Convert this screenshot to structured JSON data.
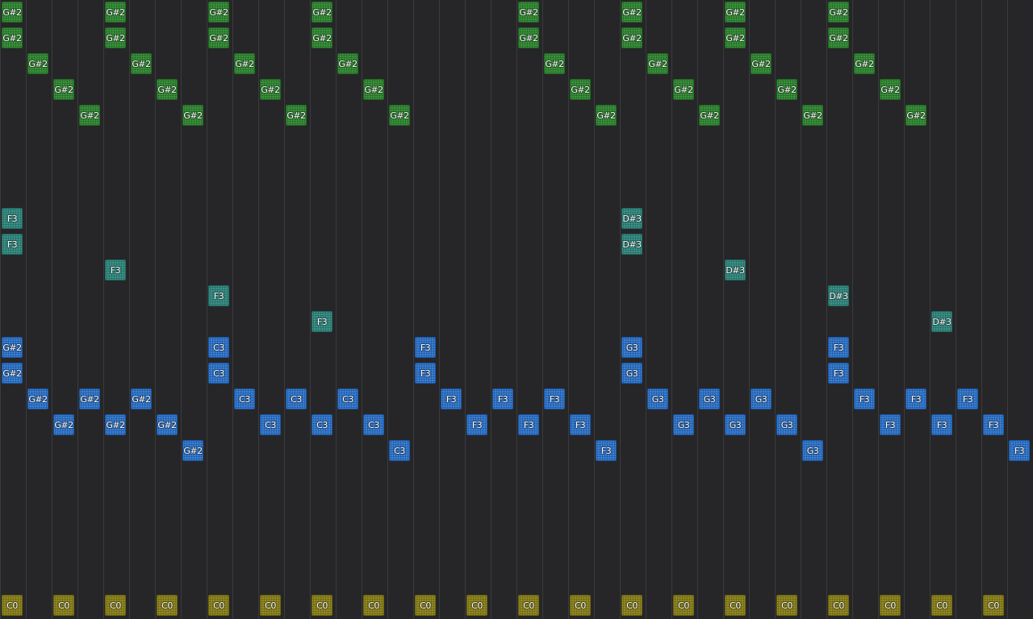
{
  "sequencer": {
    "columns": 40,
    "lanes": [
      {
        "id": "green",
        "color": "#2f8a31",
        "notes": [
          {
            "step": 0,
            "row": 0,
            "label": "G#2"
          },
          {
            "step": 0,
            "row": 1,
            "label": "G#2"
          },
          {
            "step": 1,
            "row": 2,
            "label": "G#2"
          },
          {
            "step": 2,
            "row": 3,
            "label": "G#2"
          },
          {
            "step": 3,
            "row": 4,
            "label": "G#2"
          },
          {
            "step": 4,
            "row": 0,
            "label": "G#2"
          },
          {
            "step": 4,
            "row": 1,
            "label": "G#2"
          },
          {
            "step": 5,
            "row": 2,
            "label": "G#2"
          },
          {
            "step": 6,
            "row": 3,
            "label": "G#2"
          },
          {
            "step": 7,
            "row": 4,
            "label": "G#2"
          },
          {
            "step": 8,
            "row": 0,
            "label": "G#2"
          },
          {
            "step": 8,
            "row": 1,
            "label": "G#2"
          },
          {
            "step": 9,
            "row": 2,
            "label": "G#2"
          },
          {
            "step": 10,
            "row": 3,
            "label": "G#2"
          },
          {
            "step": 11,
            "row": 4,
            "label": "G#2"
          },
          {
            "step": 12,
            "row": 0,
            "label": "G#2"
          },
          {
            "step": 12,
            "row": 1,
            "label": "G#2"
          },
          {
            "step": 13,
            "row": 2,
            "label": "G#2"
          },
          {
            "step": 14,
            "row": 3,
            "label": "G#2"
          },
          {
            "step": 15,
            "row": 4,
            "label": "G#2"
          },
          {
            "step": 20,
            "row": 0,
            "label": "G#2"
          },
          {
            "step": 20,
            "row": 1,
            "label": "G#2"
          },
          {
            "step": 21,
            "row": 2,
            "label": "G#2"
          },
          {
            "step": 22,
            "row": 3,
            "label": "G#2"
          },
          {
            "step": 23,
            "row": 4,
            "label": "G#2"
          },
          {
            "step": 24,
            "row": 0,
            "label": "G#2"
          },
          {
            "step": 24,
            "row": 1,
            "label": "G#2"
          },
          {
            "step": 25,
            "row": 2,
            "label": "G#2"
          },
          {
            "step": 26,
            "row": 3,
            "label": "G#2"
          },
          {
            "step": 27,
            "row": 4,
            "label": "G#2"
          },
          {
            "step": 28,
            "row": 0,
            "label": "G#2"
          },
          {
            "step": 28,
            "row": 1,
            "label": "G#2"
          },
          {
            "step": 29,
            "row": 2,
            "label": "G#2"
          },
          {
            "step": 30,
            "row": 3,
            "label": "G#2"
          },
          {
            "step": 31,
            "row": 4,
            "label": "G#2"
          },
          {
            "step": 32,
            "row": 0,
            "label": "G#2"
          },
          {
            "step": 32,
            "row": 1,
            "label": "G#2"
          },
          {
            "step": 33,
            "row": 2,
            "label": "G#2"
          },
          {
            "step": 34,
            "row": 3,
            "label": "G#2"
          },
          {
            "step": 35,
            "row": 4,
            "label": "G#2"
          }
        ]
      },
      {
        "id": "teal",
        "color": "#2f8a80",
        "notes": [
          {
            "step": 0,
            "row": 8,
            "label": "F3"
          },
          {
            "step": 0,
            "row": 9,
            "label": "F3"
          },
          {
            "step": 4,
            "row": 10,
            "label": "F3"
          },
          {
            "step": 8,
            "row": 11,
            "label": "F3"
          },
          {
            "step": 12,
            "row": 12,
            "label": "F3"
          },
          {
            "step": 24,
            "row": 8,
            "label": "D#3"
          },
          {
            "step": 24,
            "row": 9,
            "label": "D#3"
          },
          {
            "step": 28,
            "row": 10,
            "label": "D#3"
          },
          {
            "step": 32,
            "row": 11,
            "label": "D#3"
          },
          {
            "step": 36,
            "row": 12,
            "label": "D#3"
          }
        ]
      },
      {
        "id": "blue",
        "color": "#2a74d0",
        "notes": [
          {
            "step": 0,
            "row": 13,
            "label": "G#2"
          },
          {
            "step": 0,
            "row": 14,
            "label": "G#2"
          },
          {
            "step": 1,
            "row": 15,
            "label": "G#2"
          },
          {
            "step": 2,
            "row": 16,
            "label": "G#2"
          },
          {
            "step": 3,
            "row": 15,
            "label": "G#2"
          },
          {
            "step": 4,
            "row": 16,
            "label": "G#2"
          },
          {
            "step": 5,
            "row": 15,
            "label": "G#2"
          },
          {
            "step": 6,
            "row": 16,
            "label": "G#2"
          },
          {
            "step": 7,
            "row": 17,
            "label": "G#2"
          },
          {
            "step": 8,
            "row": 13,
            "label": "C3"
          },
          {
            "step": 8,
            "row": 14,
            "label": "C3"
          },
          {
            "step": 9,
            "row": 15,
            "label": "C3"
          },
          {
            "step": 10,
            "row": 16,
            "label": "C3"
          },
          {
            "step": 11,
            "row": 15,
            "label": "C3"
          },
          {
            "step": 12,
            "row": 16,
            "label": "C3"
          },
          {
            "step": 13,
            "row": 15,
            "label": "C3"
          },
          {
            "step": 14,
            "row": 16,
            "label": "C3"
          },
          {
            "step": 15,
            "row": 17,
            "label": "C3"
          },
          {
            "step": 16,
            "row": 13,
            "label": "F3"
          },
          {
            "step": 16,
            "row": 14,
            "label": "F3"
          },
          {
            "step": 17,
            "row": 15,
            "label": "F3"
          },
          {
            "step": 18,
            "row": 16,
            "label": "F3"
          },
          {
            "step": 19,
            "row": 15,
            "label": "F3"
          },
          {
            "step": 20,
            "row": 16,
            "label": "F3"
          },
          {
            "step": 21,
            "row": 15,
            "label": "F3"
          },
          {
            "step": 22,
            "row": 16,
            "label": "F3"
          },
          {
            "step": 23,
            "row": 17,
            "label": "F3"
          },
          {
            "step": 24,
            "row": 13,
            "label": "G3"
          },
          {
            "step": 24,
            "row": 14,
            "label": "G3"
          },
          {
            "step": 25,
            "row": 15,
            "label": "G3"
          },
          {
            "step": 26,
            "row": 16,
            "label": "G3"
          },
          {
            "step": 27,
            "row": 15,
            "label": "G3"
          },
          {
            "step": 28,
            "row": 16,
            "label": "G3"
          },
          {
            "step": 29,
            "row": 15,
            "label": "G3"
          },
          {
            "step": 30,
            "row": 16,
            "label": "G3"
          },
          {
            "step": 31,
            "row": 17,
            "label": "G3"
          },
          {
            "step": 32,
            "row": 13,
            "label": "F3"
          },
          {
            "step": 32,
            "row": 14,
            "label": "F3"
          },
          {
            "step": 33,
            "row": 15,
            "label": "F3"
          },
          {
            "step": 34,
            "row": 16,
            "label": "F3"
          },
          {
            "step": 35,
            "row": 15,
            "label": "F3"
          },
          {
            "step": 36,
            "row": 16,
            "label": "F3"
          },
          {
            "step": 37,
            "row": 15,
            "label": "F3"
          },
          {
            "step": 38,
            "row": 16,
            "label": "F3"
          },
          {
            "step": 39,
            "row": 17,
            "label": "F3"
          }
        ]
      },
      {
        "id": "olive",
        "color": "#8c8316",
        "notes": [
          {
            "step": 0,
            "row": 23,
            "label": "C0"
          },
          {
            "step": 2,
            "row": 23,
            "label": "C0"
          },
          {
            "step": 4,
            "row": 23,
            "label": "C0"
          },
          {
            "step": 6,
            "row": 23,
            "label": "C0"
          },
          {
            "step": 8,
            "row": 23,
            "label": "C0"
          },
          {
            "step": 10,
            "row": 23,
            "label": "C0"
          },
          {
            "step": 12,
            "row": 23,
            "label": "C0"
          },
          {
            "step": 14,
            "row": 23,
            "label": "C0"
          },
          {
            "step": 16,
            "row": 23,
            "label": "C0"
          },
          {
            "step": 18,
            "row": 23,
            "label": "C0"
          },
          {
            "step": 20,
            "row": 23,
            "label": "C0"
          },
          {
            "step": 22,
            "row": 23,
            "label": "C0"
          },
          {
            "step": 24,
            "row": 23,
            "label": "C0"
          },
          {
            "step": 26,
            "row": 23,
            "label": "C0"
          },
          {
            "step": 28,
            "row": 23,
            "label": "C0"
          },
          {
            "step": 30,
            "row": 23,
            "label": "C0"
          },
          {
            "step": 32,
            "row": 23,
            "label": "C0"
          },
          {
            "step": 34,
            "row": 23,
            "label": "C0"
          },
          {
            "step": 36,
            "row": 23,
            "label": "C0"
          },
          {
            "step": 38,
            "row": 23,
            "label": "C0"
          }
        ]
      }
    ]
  }
}
